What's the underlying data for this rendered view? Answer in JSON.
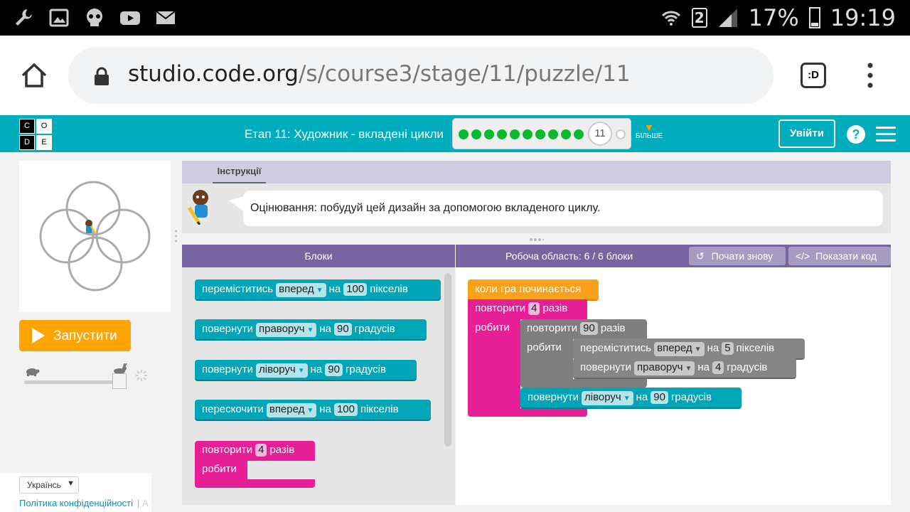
{
  "status_bar": {
    "icons": [
      "wrench-icon",
      "image-icon",
      "skull-icon",
      "youtube-icon",
      "mail-icon"
    ],
    "sim": "2",
    "battery": "17%",
    "time": "19:19"
  },
  "browser": {
    "url_domain": "studio.code.org",
    "url_path": "/s/course3/stage/11/puzzle/11",
    "tab_label": ":D"
  },
  "header": {
    "logo_letters": [
      "C",
      "O",
      "D",
      "E"
    ],
    "stage_title": "Етап 11: Художник - вкладені цикли",
    "progress_completed": 10,
    "current_puzzle": "11",
    "more_label": "БІЛЬШЕ",
    "signin_label": "Увійти",
    "help_label": "?"
  },
  "left": {
    "run_label": "Запустити",
    "language": "Українсь",
    "privacy": "Політика конфіденційності",
    "extra": "А",
    "speed": 1.0
  },
  "instructions": {
    "tab_label": "Інструкції",
    "text": "Оцінювання: побудуй цей дизайн за допомогою вкладеного циклу."
  },
  "blocks_panel": {
    "title": "Блоки",
    "toolbox": [
      {
        "a": "переміститись",
        "dd": "вперед",
        "b": "на",
        "n": "100",
        "c": "пікселів"
      },
      {
        "a": "повернути",
        "dd": "праворуч",
        "b": "на",
        "n": "90",
        "c": "градусів"
      },
      {
        "a": "повернути",
        "dd": "ліворуч",
        "b": "на",
        "n": "90",
        "c": "градусів"
      },
      {
        "a": "перескочити",
        "dd": "вперед",
        "b": "на",
        "n": "100",
        "c": "пікселів"
      }
    ],
    "repeat": {
      "a": "повторити",
      "n": "4",
      "b": "разів",
      "do": "робити"
    }
  },
  "workspace": {
    "title": "Робоча область: 6 / 6 блоки",
    "start_over": "Почати знову",
    "show_code": "Показати код",
    "when_run": "коли гра починається",
    "outer_repeat": {
      "a": "повторити",
      "n": "4",
      "b": "разів",
      "do": "робити"
    },
    "inner_repeat": {
      "a": "повторити",
      "n": "90",
      "b": "разів",
      "do": "робити"
    },
    "inner_move": {
      "a": "переміститись",
      "dd": "вперед",
      "b": "на",
      "n": "5",
      "c": "пікселів"
    },
    "inner_turn": {
      "a": "повернути",
      "dd": "праворуч",
      "b": "на",
      "n": "4",
      "c": "градусів"
    },
    "outer_turn": {
      "a": "повернути",
      "dd": "ліворуч",
      "b": "на",
      "n": "90",
      "c": "градусів"
    }
  },
  "colors": {
    "teal": "#00adbc",
    "purple": "#7665a0",
    "pink": "#e71f96",
    "cyan_block": "#00a6b8",
    "orange": "#ffa400"
  }
}
